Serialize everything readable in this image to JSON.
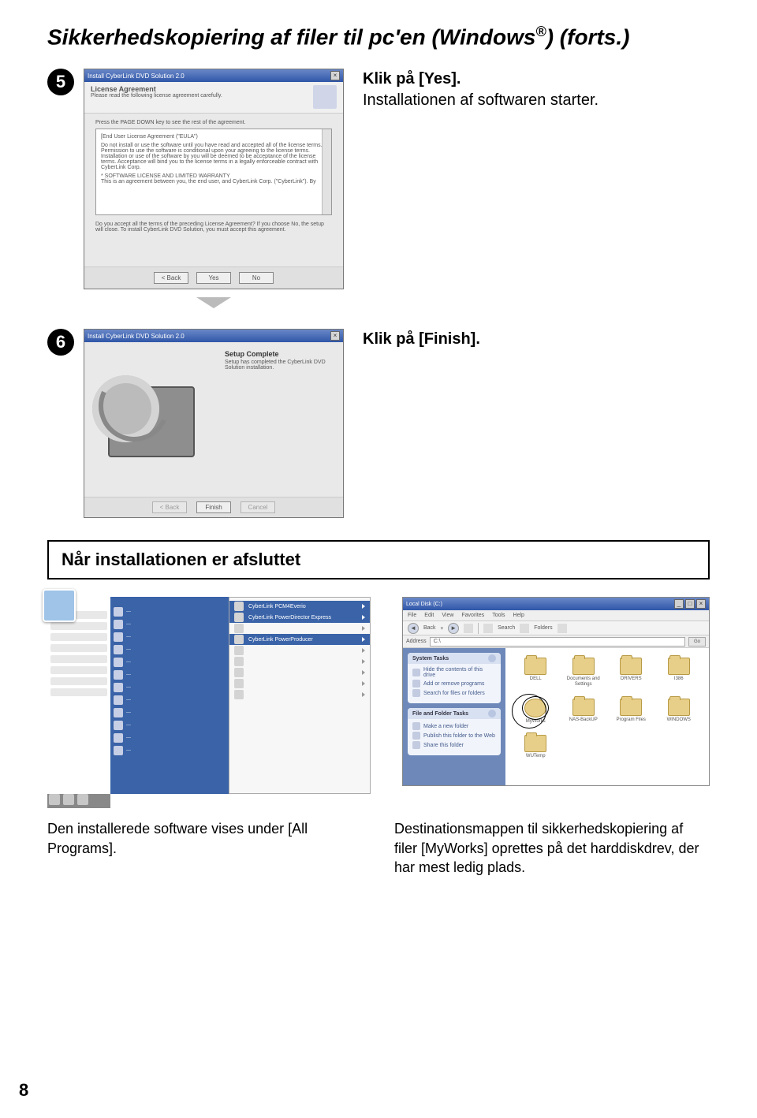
{
  "page_number": "8",
  "title_parts": {
    "pre": "Sikkerhedskopiering af filer til pc'en (Windows",
    "sup": "®",
    "post": ") (forts.)"
  },
  "step5": {
    "num": "5",
    "line1": "Klik på [Yes].",
    "line2": "Installationen af softwaren starter.",
    "win_title": "Install CyberLink DVD Solution 2.0",
    "subhead_title": "License Agreement",
    "subhead_sub": "Please read the following license agreement carefully.",
    "eula_hint": "Press the PAGE DOWN key to see the rest of the agreement.",
    "eula_text1": "[End User License Agreement (\"EULA\")",
    "eula_text2": "Do not install or use the software until you have read and accepted all of the license terms. Permission to use the software is conditional upon your agreeing to the license terms. Installation or use of the software by you will be deemed to be acceptance of the license terms. Acceptance will bind you to the license terms in a legally enforceable contract with CyberLink Corp.",
    "eula_text3": "* SOFTWARE LICENSE AND LIMITED WARRANTY",
    "eula_text4": "This is an agreement between you, the end user, and CyberLink Corp. (\"CyberLink\"). By",
    "accept": "Do you accept all the terms of the preceding License Agreement? If you choose No, the setup will close. To install CyberLink DVD Solution, you must accept this agreement.",
    "btn_back": "< Back",
    "btn_yes": "Yes",
    "btn_no": "No"
  },
  "step6": {
    "num": "6",
    "line1": "Klik på [Finish].",
    "win_title": "Install CyberLink DVD Solution 2.0",
    "header": "Setup Complete",
    "msg": "Setup has completed the CyberLink DVD Solution installation.",
    "btn_back": "< Back",
    "btn_finish": "Finish",
    "btn_cancel": "Cancel"
  },
  "section_heading": "Når installationen er afsluttet",
  "startmenu": {
    "submenu_items": [
      {
        "label": "CyberLink PCM4Everio",
        "hl": true
      },
      {
        "label": "CyberLink PowerDirector Express",
        "hl": true
      },
      {
        "label": "",
        "hl": false
      },
      {
        "label": "CyberLink PowerProducer",
        "hl": true
      },
      {
        "label": "",
        "hl": false
      },
      {
        "label": "",
        "hl": false
      },
      {
        "label": "",
        "hl": false
      },
      {
        "label": "",
        "hl": false
      },
      {
        "label": "",
        "hl": false
      }
    ]
  },
  "explorer": {
    "title": "Local Disk (C:)",
    "menu": [
      "File",
      "Edit",
      "View",
      "Favorites",
      "Tools",
      "Help"
    ],
    "toolbar": {
      "back": "Back",
      "search": "Search",
      "folders": "Folders"
    },
    "address_label": "Address",
    "address_value": "C:\\",
    "go": "Go",
    "panel1_header": "System Tasks",
    "panel1_items": [
      "Hide the contents of this drive",
      "Add or remove programs",
      "Search for files or folders"
    ],
    "panel2_header": "File and Folder Tasks",
    "panel2_items": [
      "Make a new folder",
      "Publish this folder to the Web",
      "Share this folder"
    ],
    "folders": [
      {
        "label": "DELL"
      },
      {
        "label": "Documents and Settings"
      },
      {
        "label": "DRIVERS"
      },
      {
        "label": "I386"
      },
      {
        "label": "MyWorks",
        "circled": true
      },
      {
        "label": "NAS-BackUP"
      },
      {
        "label": "Program Files"
      },
      {
        "label": "WINDOWS"
      },
      {
        "label": "WUTemp"
      }
    ]
  },
  "caption_left": "Den installerede software vises under [All Programs].",
  "caption_right": "Destinationsmappen til sikkerhedskopiering af filer [MyWorks] oprettes på det harddiskdrev, der har mest ledig plads."
}
